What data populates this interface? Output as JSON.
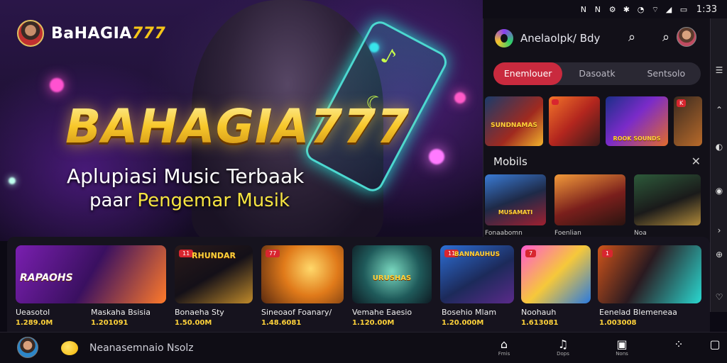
{
  "status_bar": {
    "time": "1:33"
  },
  "hero": {
    "brand_text": "BaHAGIA",
    "brand_accent": "777",
    "title": "BAHAGIA777",
    "subtitle_line1": "Aplupiasi Music Terbaak",
    "subtitle_line2_prefix": "paar",
    "subtitle_line2_highlight": "Pengemar Musik"
  },
  "panel": {
    "app_title": "Anelaolpk/ Bdy",
    "tabs": [
      {
        "label": "Enemlouer",
        "active": true
      },
      {
        "label": "Dasoatk",
        "active": false
      },
      {
        "label": "Sentsolo",
        "active": false
      }
    ],
    "row1": [
      {
        "tag": "SUNDNAMAS",
        "badge": ""
      },
      {
        "tag": "",
        "badge": ""
      },
      {
        "tag": "ROOK SOUNDS",
        "badge": "K"
      },
      {
        "tag": "",
        "badge": ""
      }
    ],
    "section_title": "Mobils",
    "row2": [
      {
        "tag": "MUSAMATI",
        "badge": "",
        "caption": "Fonaabomn"
      },
      {
        "tag": "",
        "badge": "",
        "caption": "Foenlian"
      },
      {
        "tag": "",
        "badge": "",
        "caption": "Noa"
      }
    ]
  },
  "carousel": [
    {
      "title": "Ueasotol",
      "value": "1.289.0M",
      "tag": "RAPAOHS",
      "badge": ""
    },
    {
      "title": "Maskaha Bsisia",
      "value": "1.201091",
      "tag": "",
      "badge": ""
    },
    {
      "title": "Bonaeha Sty",
      "value": "1.50.00M",
      "tag": "RHUNDAR",
      "badge": "11"
    },
    {
      "title": "Sineoaof Foanary/",
      "value": "1.48.6081",
      "tag": "",
      "badge": "77"
    },
    {
      "title": "Vemahe Eaesio",
      "value": "1.120.00M",
      "tag": "URUSHAS",
      "badge": ""
    },
    {
      "title": "Bosehio Mlam",
      "value": "1.20.000M",
      "tag": "BANNAUHUS",
      "badge": "11"
    },
    {
      "title": "Noohauh",
      "value": "1.613081",
      "tag": "",
      "badge": "7"
    },
    {
      "title": "Eenelad Blemeneaa",
      "value": "1.003008",
      "tag": "",
      "badge": "1"
    }
  ],
  "bottom_bar": {
    "text": "Neanasemnaio Nsolz",
    "nav": [
      {
        "icon": "home-icon",
        "label": "Fmis"
      },
      {
        "icon": "music-icon",
        "label": "Dops"
      },
      {
        "icon": "library-icon",
        "label": "Nons"
      },
      {
        "icon": "more-icon",
        "label": ""
      },
      {
        "icon": "chat-icon",
        "label": ""
      }
    ]
  },
  "colors": {
    "accent_red": "#c92a3e",
    "gold": "#ffd23a",
    "neon_teal": "#29d3c9"
  }
}
